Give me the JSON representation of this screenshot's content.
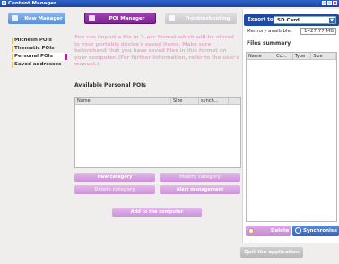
{
  "window": {
    "title": "Content Manager"
  },
  "tabs": {
    "new": "New Manager",
    "poi": "POI Manager",
    "troubleshooting": "Troubleshooting"
  },
  "sidebar": {
    "items": [
      {
        "label": "Michelin POIs"
      },
      {
        "label": "Thematic POIs"
      },
      {
        "label": "Personal POIs"
      },
      {
        "label": "Saved addresses"
      }
    ]
  },
  "intro": "You can import a file in \"-.asc format which will be stored in your portable device's saved items. Make sure beforehand that you have saved files in this format on your computer. (For further information, refer to the user's manual.)",
  "poi_list": {
    "title": "Available Personal POIs",
    "columns": [
      "Name",
      "Size",
      "synch..."
    ]
  },
  "poi_buttons": {
    "new_category": "New category",
    "modify_category": "Modify category",
    "delete_category": "Delete category",
    "alert_management": "Alert management",
    "add_category": "Add to the computer"
  },
  "export": {
    "label": "Export to",
    "value": "SD Card",
    "memory_label": "Memory available:",
    "memory_value": "1427.77 MB"
  },
  "files": {
    "title": "Files summary",
    "columns": [
      "Name",
      "Co...",
      "Type",
      "Size"
    ]
  },
  "actions": {
    "delete": "Delete",
    "sync": "Synchronise",
    "exit": "Quit the application"
  }
}
